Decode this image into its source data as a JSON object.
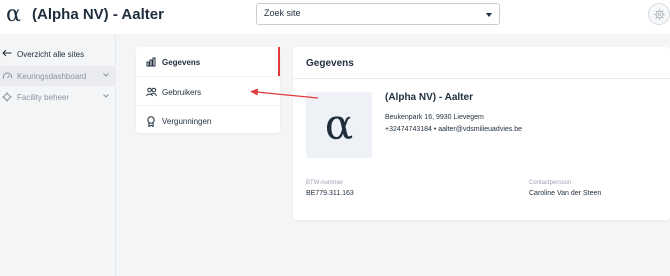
{
  "header": {
    "logo": "α",
    "site_title": "(Alpha NV) - Aalter",
    "site_select": {
      "value": "Zoek site"
    },
    "settings_icon": "gear-icon"
  },
  "sidebar": {
    "back_label": "Overzicht alle sites",
    "items": [
      {
        "label": "Keuringsdashboard",
        "icon": "gauge-icon"
      },
      {
        "label": "Facility beheer",
        "icon": "gear-icon"
      }
    ]
  },
  "tabs": [
    {
      "label": "Gegevens",
      "icon": "chart-icon",
      "active": true
    },
    {
      "label": "Gebruikers",
      "icon": "users-icon"
    },
    {
      "label": "Vergunningen",
      "icon": "badge-icon"
    }
  ],
  "details": {
    "title": "Gegevens",
    "avatar_glyph": "α",
    "company_name": "(Alpha NV) - Aalter",
    "address": "Beukenpark 16, 9930 Lievegem",
    "contact": "+32474743184 • aalter@vdsmilieuadvies.be",
    "btw_label": "BTW-nummer",
    "btw_value": "BE779.311.163",
    "contact_label": "Contactpersoon",
    "contact_value": "Caroline Van der Steen"
  },
  "colors": {
    "accent_red": "#e03a3a",
    "text": "#1f2d3d",
    "muted": "#9aa3af"
  }
}
